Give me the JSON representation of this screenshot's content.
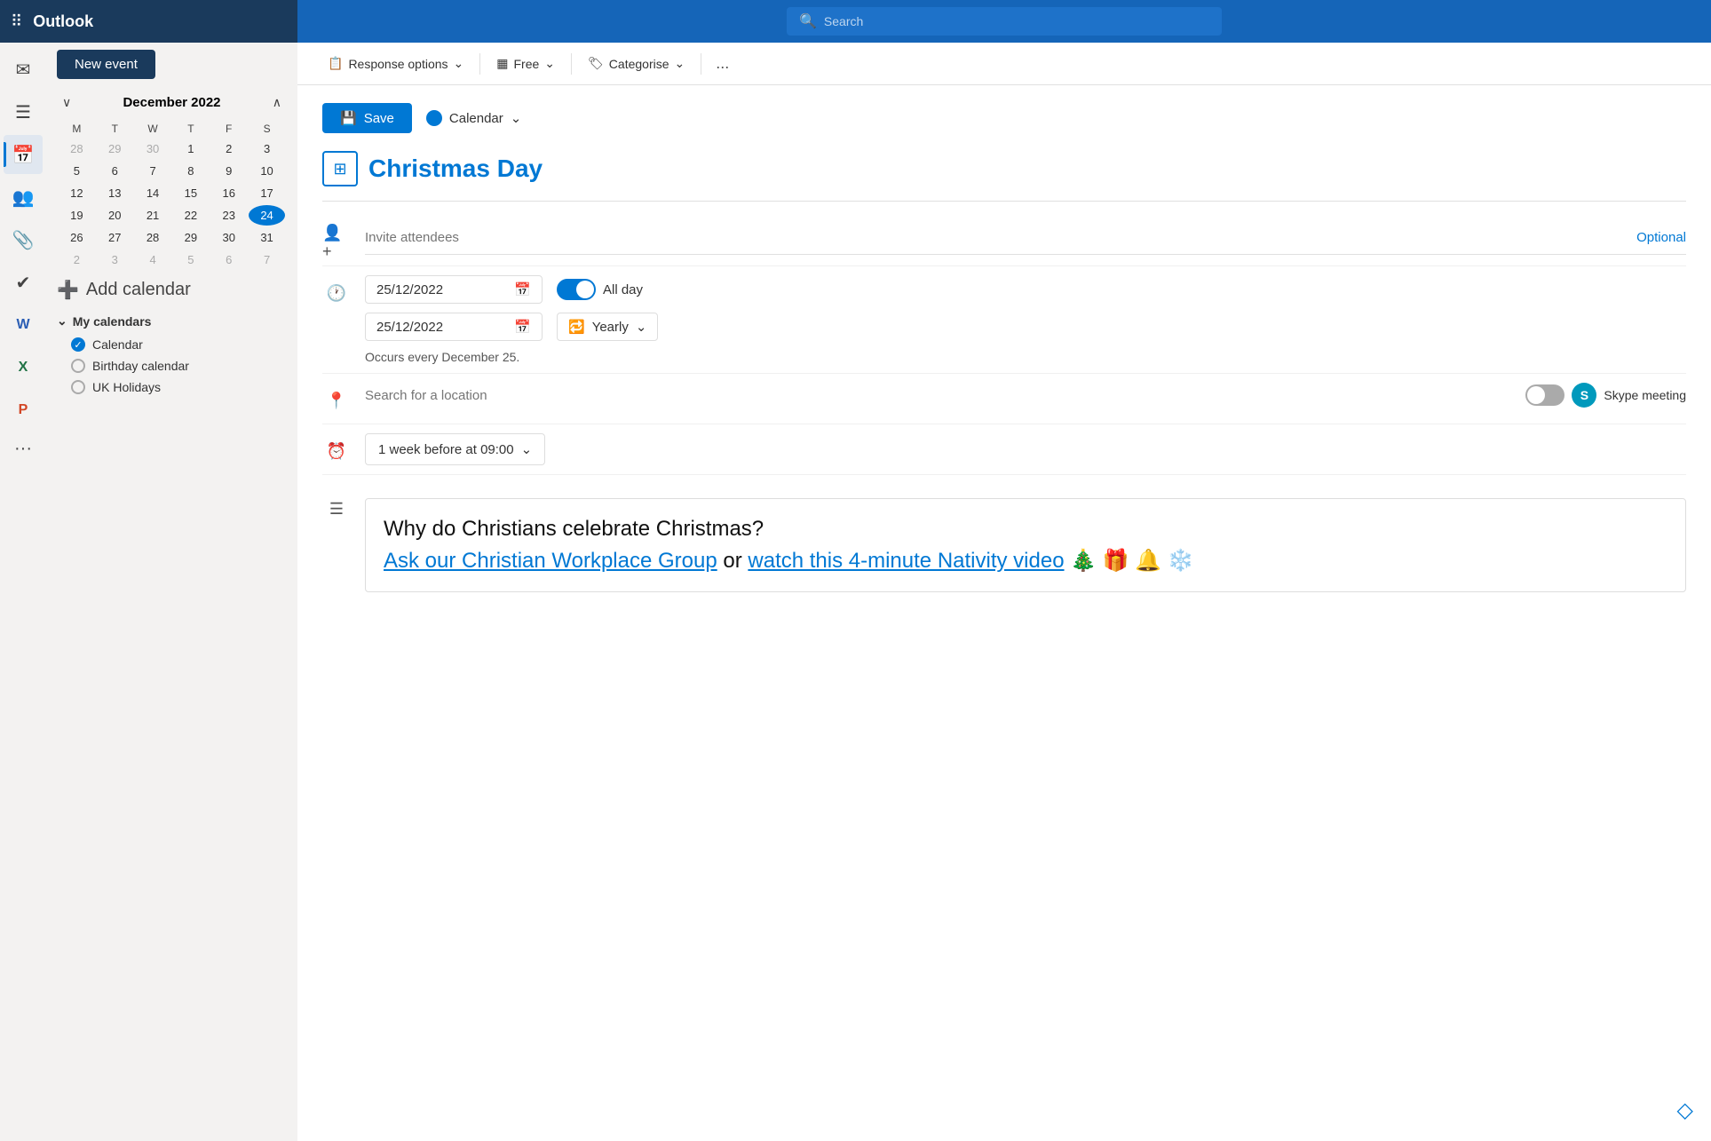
{
  "app": {
    "name": "Outlook"
  },
  "top_bar": {
    "search_placeholder": "Search"
  },
  "toolbar": {
    "response_options_label": "Response options",
    "free_label": "Free",
    "categorise_label": "Categorise",
    "more_label": "..."
  },
  "form": {
    "save_label": "Save",
    "calendar_label": "Calendar",
    "event_title": "Christmas Day",
    "invite_attendees_placeholder": "Invite attendees",
    "optional_label": "Optional",
    "start_date": "25/12/2022",
    "end_date": "25/12/2022",
    "all_day_label": "All day",
    "recurrence_label": "Yearly",
    "occurs_text": "Occurs every December 25.",
    "location_placeholder": "Search for a location",
    "skype_label": "Skype meeting",
    "reminder_label": "1 week before at 09:00",
    "body_text_plain": "Why do Christians celebrate Christmas?",
    "body_link1": "Ask our Christian Workplace Group",
    "body_or": " or ",
    "body_link2": "watch this 4-minute Nativity video",
    "body_emojis": " 🎄 🎁 🔔 ❄️"
  },
  "sidebar": {
    "month_title": "December 2022",
    "new_event_label": "New event",
    "add_calendar_label": "Add calendar",
    "my_calendars_label": "My calendars",
    "calendars": [
      {
        "name": "Calendar",
        "active": true
      },
      {
        "name": "Birthday calendar",
        "active": false
      },
      {
        "name": "UK Holidays",
        "active": false
      }
    ],
    "days_header": [
      "M",
      "T",
      "W",
      "T",
      "F",
      "S"
    ],
    "weeks": [
      [
        "28",
        "29",
        "30",
        "1",
        "2",
        "3"
      ],
      [
        "5",
        "6",
        "7",
        "8",
        "9",
        "10"
      ],
      [
        "12",
        "13",
        "14",
        "15",
        "16",
        "17"
      ],
      [
        "19",
        "20",
        "21",
        "22",
        "23",
        "24"
      ],
      [
        "26",
        "27",
        "28",
        "29",
        "30",
        "31"
      ],
      [
        "2",
        "3",
        "4",
        "5",
        "6",
        "7"
      ]
    ],
    "other_month_cells": [
      "28",
      "29",
      "30",
      "2",
      "3",
      "4",
      "5",
      "6",
      "7"
    ]
  }
}
